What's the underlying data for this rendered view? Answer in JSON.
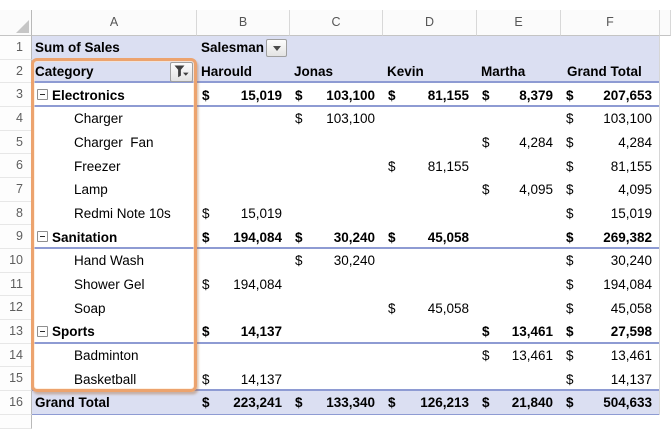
{
  "spreadsheet": {
    "column_letters": [
      "A",
      "B",
      "C",
      "D",
      "E",
      "F"
    ],
    "row_numbers": [
      "1",
      "2",
      "3",
      "4",
      "5",
      "6",
      "7",
      "8",
      "9",
      "10",
      "11",
      "12",
      "13",
      "14",
      "15",
      "16"
    ]
  },
  "pivot": {
    "value_field_label": "Sum of Sales",
    "column_field": {
      "label": "Salesman",
      "dropdown_icon": "down-arrow"
    },
    "row_field": {
      "label": "Category",
      "filter_icon": "funnel-with-down-arrow"
    },
    "salesman_headers": [
      "Harould",
      "Jonas",
      "Kevin",
      "Martha"
    ],
    "grand_total_header": "Grand Total",
    "currency_symbol": "$",
    "collapse_glyph": "minus",
    "rows": [
      {
        "row": 3,
        "type": "category",
        "label": "Electronics",
        "values": [
          "15,019",
          "103,100",
          "81,155",
          "8,379",
          "207,653"
        ]
      },
      {
        "row": 4,
        "type": "item",
        "label": "Charger",
        "values": [
          null,
          "103,100",
          null,
          null,
          "103,100"
        ]
      },
      {
        "row": 5,
        "type": "item",
        "label": "Charger  Fan",
        "values": [
          null,
          null,
          null,
          "4,284",
          "4,284"
        ]
      },
      {
        "row": 6,
        "type": "item",
        "label": "Freezer",
        "values": [
          null,
          null,
          "81,155",
          null,
          "81,155"
        ]
      },
      {
        "row": 7,
        "type": "item",
        "label": "Lamp",
        "values": [
          null,
          null,
          null,
          "4,095",
          "4,095"
        ]
      },
      {
        "row": 8,
        "type": "item",
        "label": "Redmi Note 10s",
        "values": [
          "15,019",
          null,
          null,
          null,
          "15,019"
        ]
      },
      {
        "row": 9,
        "type": "category",
        "label": "Sanitation",
        "values": [
          "194,084",
          "30,240",
          "45,058",
          null,
          "269,382"
        ]
      },
      {
        "row": 10,
        "type": "item",
        "label": "Hand Wash",
        "values": [
          null,
          "30,240",
          null,
          null,
          "30,240"
        ]
      },
      {
        "row": 11,
        "type": "item",
        "label": "Shower Gel",
        "values": [
          "194,084",
          null,
          null,
          null,
          "194,084"
        ]
      },
      {
        "row": 12,
        "type": "item",
        "label": "Soap",
        "values": [
          null,
          null,
          "45,058",
          null,
          "45,058"
        ]
      },
      {
        "row": 13,
        "type": "category",
        "label": "Sports",
        "values": [
          "14,137",
          null,
          null,
          "13,461",
          "27,598"
        ]
      },
      {
        "row": 14,
        "type": "item",
        "label": "Badminton",
        "values": [
          null,
          null,
          null,
          "13,461",
          "13,461"
        ]
      },
      {
        "row": 15,
        "type": "item",
        "label": "Basketball",
        "values": [
          "14,137",
          null,
          null,
          null,
          "14,137"
        ]
      }
    ],
    "grand_total_row": {
      "row": 16,
      "label": "Grand Total",
      "values": [
        "223,241",
        "133,340",
        "126,213",
        "21,840",
        "504,633"
      ]
    }
  },
  "highlight": {
    "color": "#eca36e",
    "around": "Category column rows 2-15"
  },
  "colors": {
    "pivot_header_fill": "#dbdff2",
    "group_border_blue": "#8e9bd3",
    "highlight_orange": "#eca36e"
  }
}
